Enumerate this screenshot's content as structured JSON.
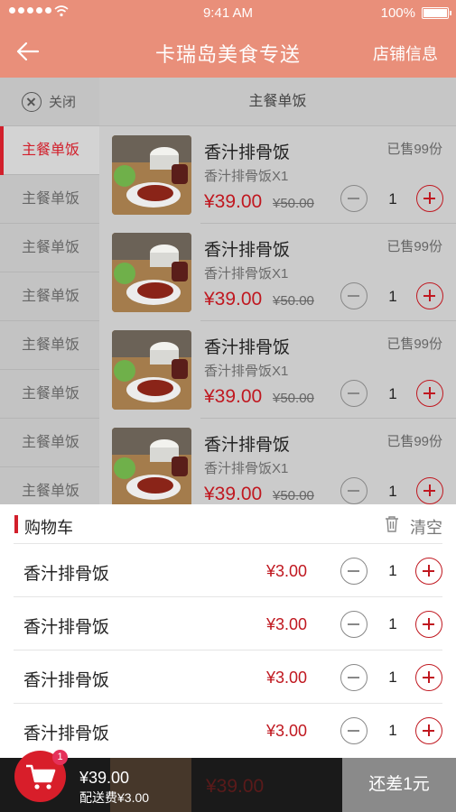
{
  "status_bar": {
    "time": "9:41 AM",
    "battery": "100%"
  },
  "header": {
    "title": "卡瑞岛美食专送",
    "store_info": "店铺信息"
  },
  "sidebar": {
    "close_label": "关闭",
    "items": [
      {
        "label": "主餐单饭"
      },
      {
        "label": "主餐单饭"
      },
      {
        "label": "主餐单饭"
      },
      {
        "label": "主餐单饭"
      },
      {
        "label": "主餐单饭"
      },
      {
        "label": "主餐单饭"
      },
      {
        "label": "主餐单饭"
      },
      {
        "label": "主餐单饭"
      }
    ]
  },
  "content": {
    "title": "主餐单饭",
    "dishes": [
      {
        "name": "香汁排骨饭",
        "desc": "香汁排骨饭X1",
        "price": "¥39.00",
        "old_price": "¥50.00",
        "sold": "已售99份",
        "qty": "1"
      },
      {
        "name": "香汁排骨饭",
        "desc": "香汁排骨饭X1",
        "price": "¥39.00",
        "old_price": "¥50.00",
        "sold": "已售99份",
        "qty": "1"
      },
      {
        "name": "香汁排骨饭",
        "desc": "香汁排骨饭X1",
        "price": "¥39.00",
        "old_price": "¥50.00",
        "sold": "已售99份",
        "qty": "1"
      },
      {
        "name": "香汁排骨饭",
        "desc": "香汁排骨饭X1",
        "price": "¥39.00",
        "old_price": "¥50.00",
        "sold": "已售99份",
        "qty": "1"
      }
    ]
  },
  "cart": {
    "title": "购物车",
    "clear_label": "清空",
    "items": [
      {
        "name": "香汁排骨饭",
        "price": "¥3.00",
        "qty": "1"
      },
      {
        "name": "香汁排骨饭",
        "price": "¥3.00",
        "qty": "1"
      },
      {
        "name": "香汁排骨饭",
        "price": "¥3.00",
        "qty": "1"
      },
      {
        "name": "香汁排骨饭",
        "price": "¥3.00",
        "qty": "1"
      }
    ]
  },
  "bottom_bar": {
    "badge_count": "1",
    "total": "¥39.00",
    "delivery_fee": "配送费¥3.00",
    "peek_price": "¥39.00",
    "checkout_label": "还差1元"
  },
  "colors": {
    "accent": "#d21f2b",
    "header_bg": "#e98f7a",
    "bottom_bg": "#1a1a1a",
    "checkout_bg": "#8a8a8a"
  },
  "icons": [
    "back-arrow-icon",
    "close-circle-icon",
    "minus-circle-icon",
    "plus-circle-icon",
    "trash-icon",
    "cart-icon",
    "wifi-icon",
    "battery-icon"
  ]
}
